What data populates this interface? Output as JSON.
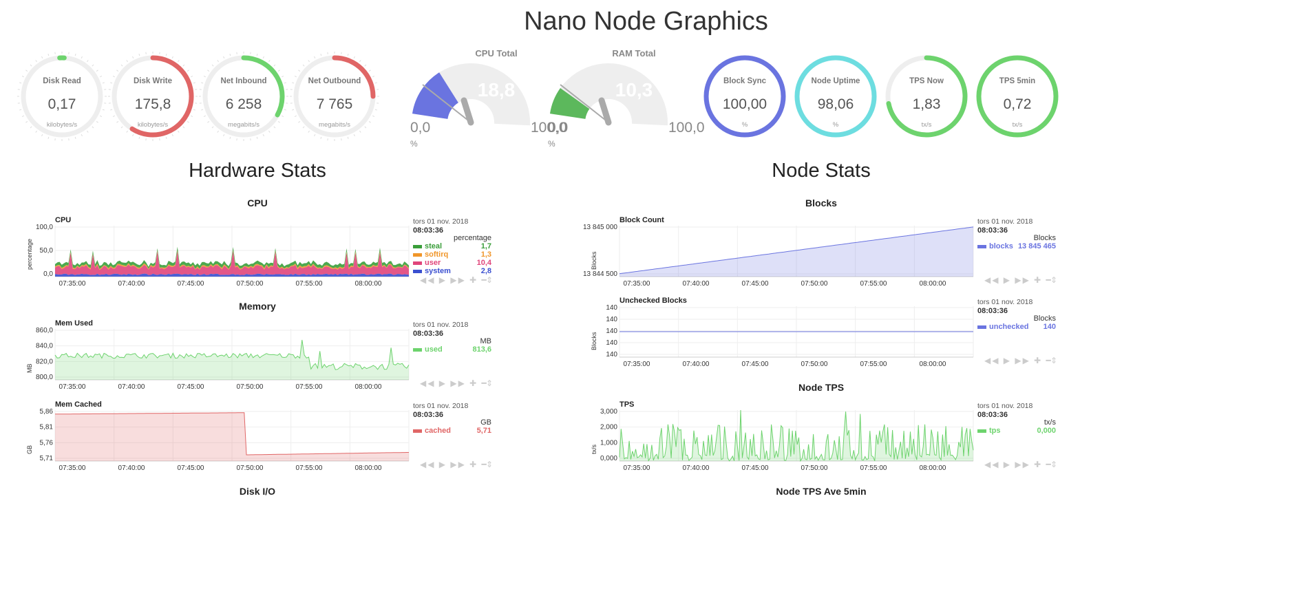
{
  "page_title": "Nano Node Graphics",
  "gauges": [
    {
      "label": "Disk Read",
      "value": "0,17",
      "unit": "kilobytes/s",
      "fraction": 0.02,
      "color": "#6dd36d"
    },
    {
      "label": "Disk Write",
      "value": "175,8",
      "unit": "kilobytes/s",
      "fraction": 0.6,
      "color": "#e06666"
    },
    {
      "label": "Net Inbound",
      "value": "6 258",
      "unit": "megabits/s",
      "fraction": 0.33,
      "color": "#6dd36d"
    },
    {
      "label": "Net Outbound",
      "value": "7 765",
      "unit": "megabits/s",
      "fraction": 0.25,
      "color": "#e06666"
    },
    {
      "label": "Block Sync",
      "value": "100,00",
      "unit": "%",
      "fraction": 1.0,
      "color": "#6a74e0"
    },
    {
      "label": "Node Uptime",
      "value": "98,06",
      "unit": "%",
      "fraction": 1.0,
      "color": "#6ddde0"
    },
    {
      "label": "TPS Now",
      "value": "1,83",
      "unit": "tx/s",
      "fraction": 0.72,
      "color": "#6dd36d"
    },
    {
      "label": "TPS 5min",
      "value": "0,72",
      "unit": "tx/s",
      "fraction": 1.0,
      "color": "#6dd36d"
    }
  ],
  "half_gauges": [
    {
      "label": "CPU Total",
      "value": "18,8",
      "min": "0,0",
      "max": "100,0",
      "unit": "%",
      "fraction": 0.188,
      "color": "#6a74e0"
    },
    {
      "label": "RAM Total",
      "value": "10,3",
      "min": "0,0",
      "max": "100,0",
      "unit": "%",
      "fraction": 0.103,
      "color": "#5cb85c"
    }
  ],
  "sections": {
    "hardware": "Hardware Stats",
    "node": "Node Stats"
  },
  "chart_groups": {
    "cpu": "CPU",
    "memory": "Memory",
    "disk_io": "Disk I/O",
    "blocks": "Blocks",
    "node_tps": "Node TPS",
    "node_tps_ave": "Node TPS Ave 5min"
  },
  "legend_date": "tors 01 nov. 2018",
  "legend_time": "08:03:36",
  "controls": "◀◀ ▶ ▶▶ ✚ ━",
  "resize_icon": "⇕",
  "x_ticks": [
    "07:35:00",
    "07:40:00",
    "07:45:00",
    "07:50:00",
    "07:55:00",
    "08:00:00"
  ],
  "chart_data": [
    {
      "id": "cpu",
      "type": "area",
      "title": "CPU",
      "ylabel": "percentage",
      "units": "percentage",
      "yticks": [
        "100,0",
        "50,0",
        "0,0"
      ],
      "ylim": [
        0,
        100
      ],
      "stacked": true,
      "series": [
        {
          "name": "steal",
          "value": "1,7",
          "color": "#3a9e3a"
        },
        {
          "name": "softirq",
          "value": "1,3",
          "color": "#f0962a"
        },
        {
          "name": "user",
          "value": "10,4",
          "color": "#e0457b"
        },
        {
          "name": "system",
          "value": "2,8",
          "color": "#3a4fd0"
        }
      ]
    },
    {
      "id": "mem_used",
      "type": "area",
      "title": "Mem Used",
      "ylabel": "MB",
      "units": "MB",
      "yticks": [
        "860,0",
        "840,0",
        "820,0",
        "800,0"
      ],
      "ylim": [
        790,
        870
      ],
      "series": [
        {
          "name": "used",
          "value": "813,6",
          "color": "#6dd36d"
        }
      ]
    },
    {
      "id": "mem_cached",
      "type": "area",
      "title": "Mem Cached",
      "ylabel": "GB",
      "units": "GB",
      "yticks": [
        "5,86",
        "5,81",
        "5,76",
        "5,71"
      ],
      "ylim": [
        5.69,
        5.88
      ],
      "series": [
        {
          "name": "cached",
          "value": "5,71",
          "color": "#e06666"
        }
      ]
    },
    {
      "id": "block_count",
      "type": "area",
      "title": "Block Count",
      "ylabel": "Blocks",
      "units": "Blocks",
      "yticks": [
        "13 845 000",
        "13 844 500"
      ],
      "ylim": [
        13844100,
        13845500
      ],
      "series": [
        {
          "name": "blocks",
          "value": "13 845 465",
          "color": "#6a74e0"
        }
      ]
    },
    {
      "id": "unchecked",
      "type": "line",
      "title": "Unchecked Blocks",
      "ylabel": "Blocks",
      "units": "Blocks",
      "yticks": [
        "140",
        "140",
        "140",
        "140",
        "140"
      ],
      "ylim": [
        139,
        141
      ],
      "series": [
        {
          "name": "unchecked",
          "value": "140",
          "color": "#6a74e0"
        }
      ]
    },
    {
      "id": "tps",
      "type": "area",
      "title": "TPS",
      "ylabel": "tx/s",
      "units": "tx/s",
      "yticks": [
        "3,000",
        "2,000",
        "1,000",
        "0,000"
      ],
      "ylim": [
        0,
        3
      ],
      "series": [
        {
          "name": "tps",
          "value": "0,000",
          "color": "#6dd36d"
        }
      ]
    }
  ]
}
